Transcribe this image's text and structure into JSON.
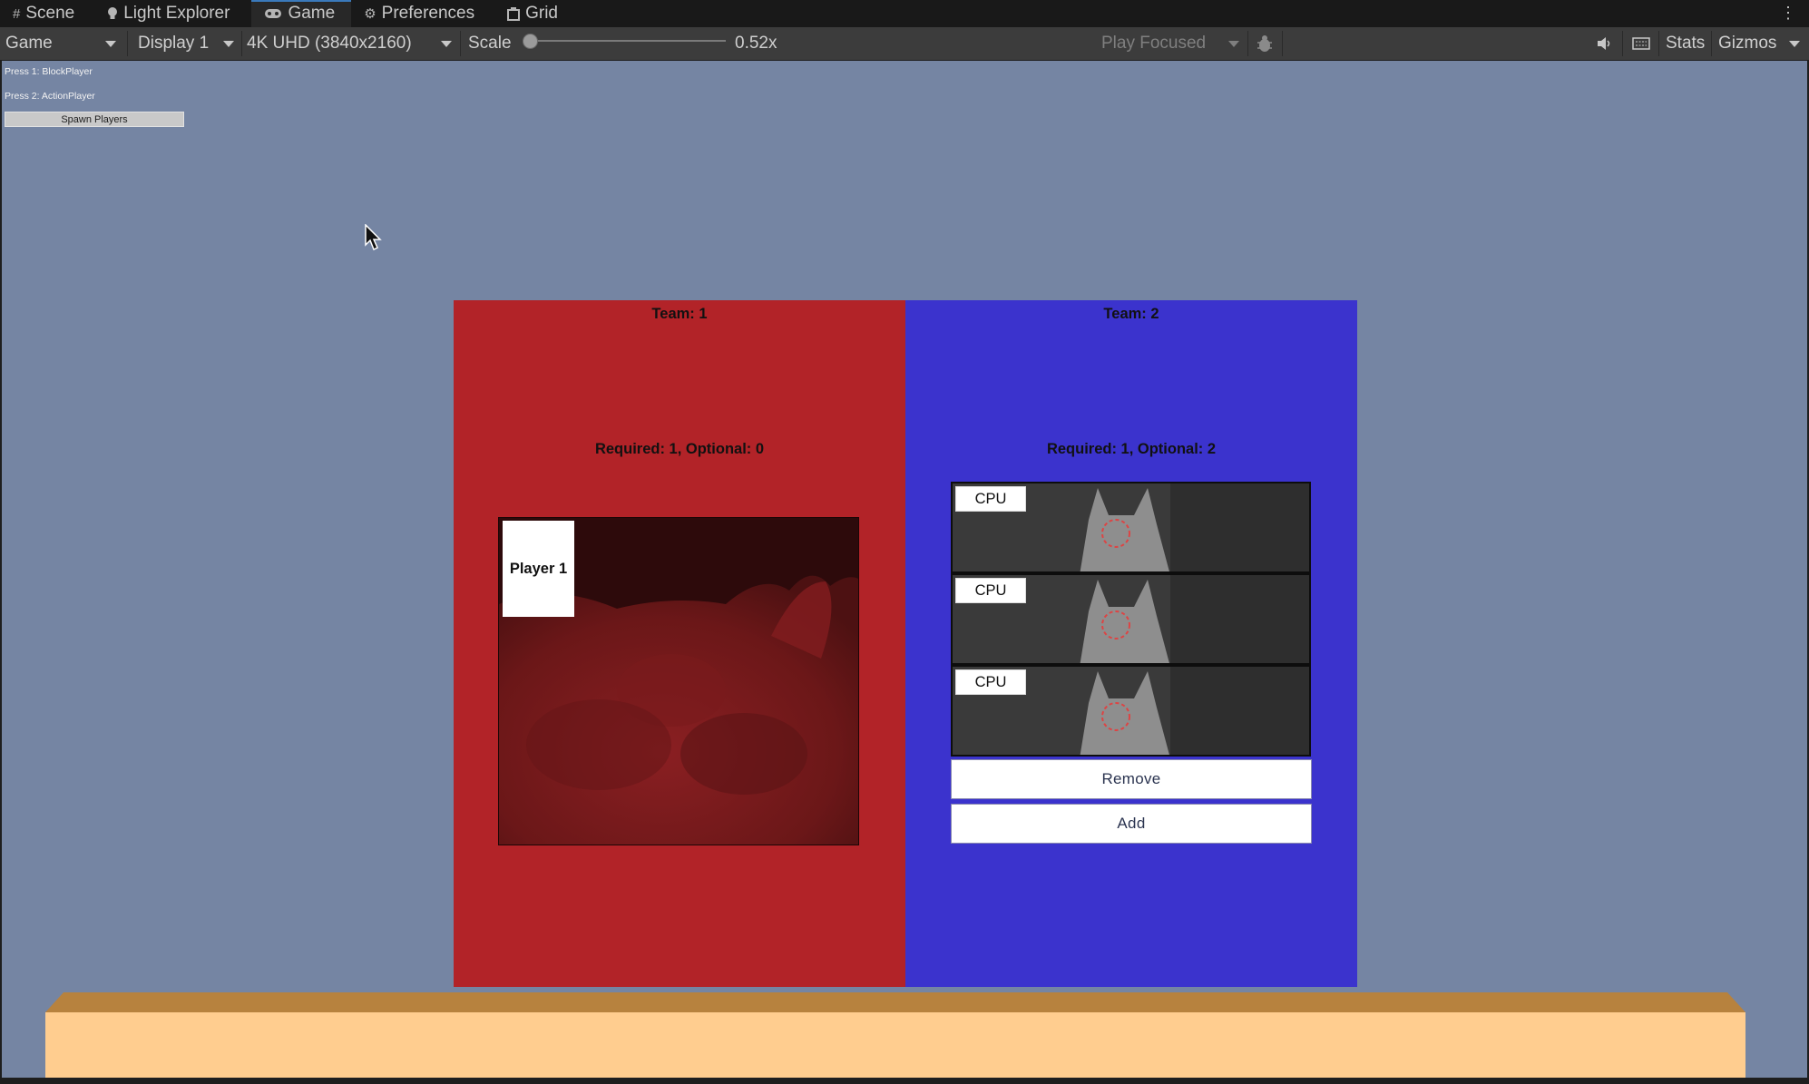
{
  "tabs": [
    {
      "icon": "grid-hash-icon",
      "label": "Scene"
    },
    {
      "icon": "lightbulb-icon",
      "label": "Light Explorer"
    },
    {
      "icon": "gamepad-icon",
      "label": "Game"
    },
    {
      "icon": "gear-icon",
      "label": "Preferences"
    },
    {
      "icon": "grid-snap-icon",
      "label": "Grid"
    }
  ],
  "active_tab": "Game",
  "toolbar": {
    "view_mode": "Game",
    "display": "Display 1",
    "resolution": "4K UHD (3840x2160)",
    "scale_label": "Scale",
    "scale_value": "0.52x",
    "play_mode": "Play Focused",
    "stats_label": "Stats",
    "gizmos_label": "Gizmos"
  },
  "debug_overlay": {
    "line1": "Press 1: BlockPlayer",
    "line2": "Press 2: ActionPlayer",
    "spawn_button": "Spawn Players"
  },
  "teams": [
    {
      "title": "Team: 1",
      "requirement": "Required: 1, Optional: 0",
      "color": "#b22328",
      "players": [
        {
          "label": "Player 1"
        }
      ]
    },
    {
      "title": "Team: 2",
      "requirement": "Required: 1, Optional: 2",
      "color": "#3b33cd",
      "players": [
        {
          "label": "CPU"
        },
        {
          "label": "CPU"
        },
        {
          "label": "CPU"
        }
      ],
      "remove_button": "Remove",
      "add_button": "Add"
    }
  ],
  "colors": {
    "game_background": "#7585a3",
    "floor_top": "#b7823e",
    "floor_front": "#ffcd8f",
    "editor_toolbar": "#3c3c3c",
    "tab_accent": "#3a79bb"
  }
}
